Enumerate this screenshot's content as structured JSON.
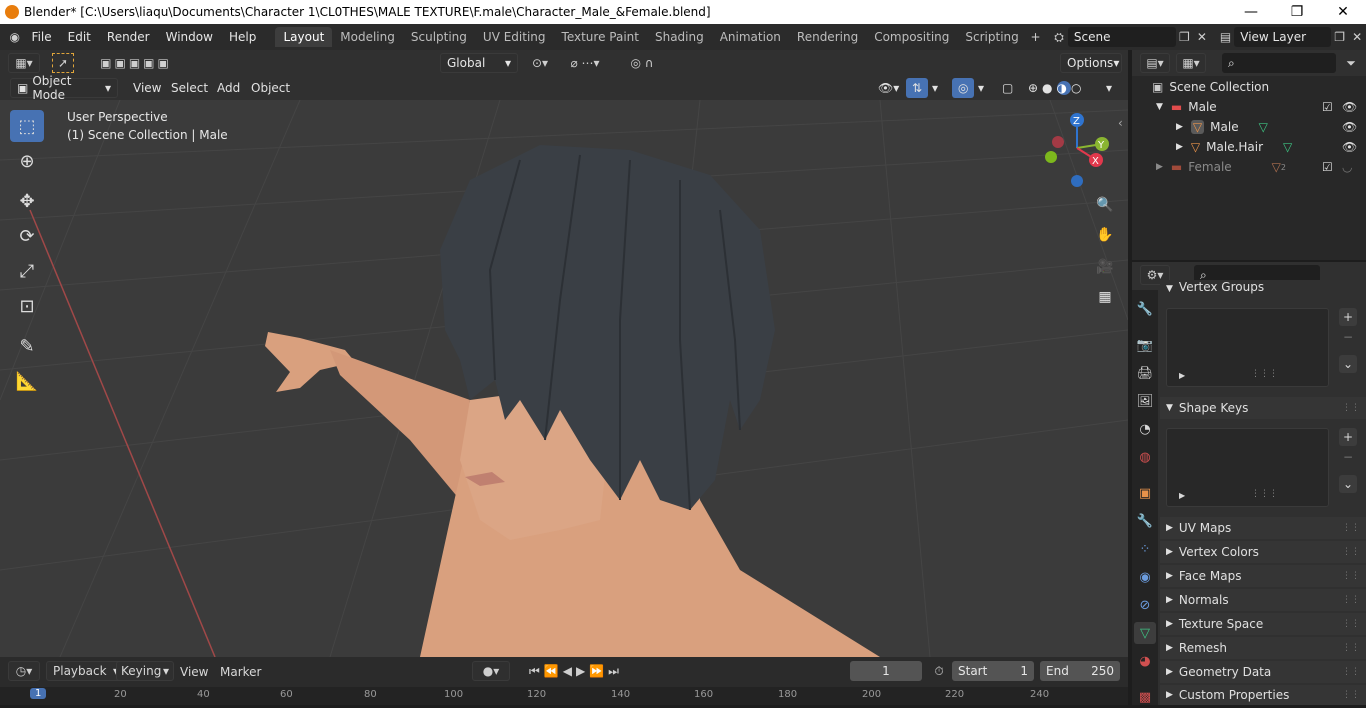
{
  "window": {
    "title": "Blender* [C:\\Users\\liaqu\\Documents\\Character 1\\CL0THES\\MALE TEXTURE\\F.male\\Character_Male_&Female.blend]",
    "minimize": "—",
    "maximize": "❐",
    "close": "✕"
  },
  "menu": {
    "items": [
      "File",
      "Edit",
      "Render",
      "Window",
      "Help"
    ]
  },
  "workspaces": [
    "Layout",
    "Modeling",
    "Sculpting",
    "UV Editing",
    "Texture Paint",
    "Shading",
    "Animation",
    "Rendering",
    "Compositing",
    "Scripting"
  ],
  "active_workspace": "Layout",
  "scene": {
    "name": "Scene"
  },
  "view_layer": {
    "name": "View Layer"
  },
  "toolbar": {
    "transform_orientation": "Global",
    "options_label": "Options"
  },
  "header": {
    "mode": "Object Mode",
    "menus": [
      "View",
      "Select",
      "Add",
      "Object"
    ]
  },
  "viewport": {
    "perspective_label": "User Perspective",
    "collection_label": "(1) Scene Collection | Male",
    "gizmo": {
      "z": "Z",
      "y": "Y",
      "x": "X"
    }
  },
  "outliner": {
    "root": "Scene Collection",
    "items": [
      {
        "label": "Male",
        "type": "collection"
      },
      {
        "label": "Male",
        "type": "object"
      },
      {
        "label": "Male.Hair",
        "type": "object"
      },
      {
        "label": "Female",
        "type": "collection",
        "badge": "2"
      }
    ]
  },
  "properties": {
    "panels": {
      "vertex_groups": "Vertex Groups",
      "shape_keys": "Shape Keys",
      "collapsed": [
        "UV Maps",
        "Vertex Colors",
        "Face Maps",
        "Normals",
        "Texture Space",
        "Remesh",
        "Geometry Data",
        "Custom Properties"
      ]
    }
  },
  "timeline": {
    "menus": [
      "Playback",
      "Keying",
      "View",
      "Marker"
    ],
    "current_frame": "1",
    "start_label": "Start",
    "start_value": "1",
    "end_label": "End",
    "end_value": "250",
    "ruler": [
      "1",
      "20",
      "40",
      "60",
      "80",
      "100",
      "120",
      "140",
      "160",
      "180",
      "200",
      "220",
      "240"
    ]
  },
  "colors": {
    "accent": "#4772b3",
    "viewport_bg": "#3b3b3b",
    "skin": "#d9a07e",
    "hair": "#3a3f45"
  }
}
